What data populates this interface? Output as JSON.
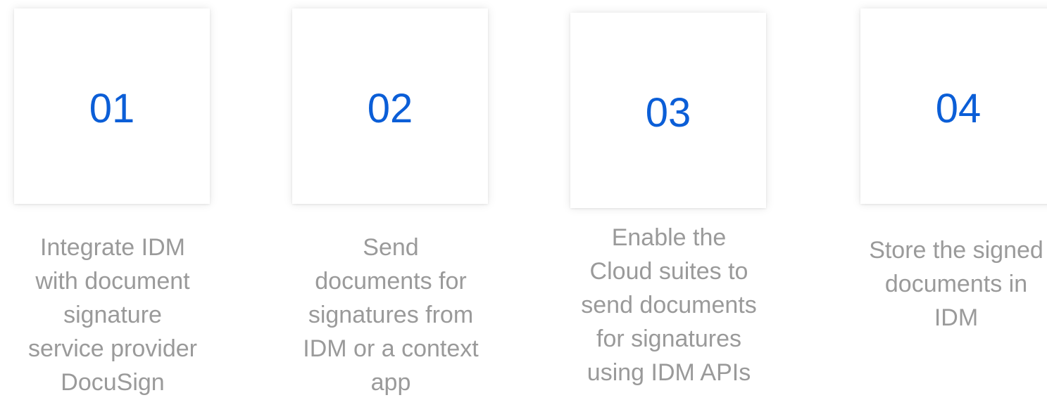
{
  "steps": [
    {
      "number": "01",
      "text": "Integrate IDM\nwith document\nsignature\nservice provider\nDocuSign"
    },
    {
      "number": "02",
      "text": "Send\ndocuments for\nsignatures from\nIDM or a context\napp"
    },
    {
      "number": "03",
      "text": "Enable the\nCloud suites to\nsend documents\nfor signatures\nusing IDM APIs"
    },
    {
      "number": "04",
      "text": "Store the signed\ndocuments in\nIDM"
    }
  ],
  "colors": {
    "accent": "#0b5ed7",
    "text_muted": "#9a9a9a",
    "card_bg": "#ffffff"
  }
}
